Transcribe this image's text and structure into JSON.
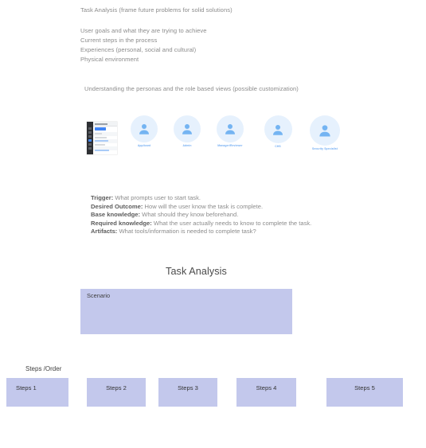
{
  "notes_top": [
    "Task Analysis (frame future problems for solid solutions)",
    "User goals and what they are trying to achieve",
    "Current steps in the process",
    "Experiences (personal, social and cultural)",
    "Physical environment"
  ],
  "notes_personas": "Understanding the personas and the role based views (possible customization)",
  "personas": [
    {
      "label": "Applicant",
      "icon": "user-avatar-icon"
    },
    {
      "label": "Admin",
      "icon": "user-avatar-icon"
    },
    {
      "label": "Manager/Reviewer",
      "icon": "user-avatar-icon"
    },
    {
      "label": "CHS",
      "icon": "user-avatar-icon"
    },
    {
      "label": "Security Specialist",
      "icon": "user-avatar-icon"
    }
  ],
  "app_thumbnail": {
    "name": "app-screenshot-thumbnail"
  },
  "definitions": [
    {
      "term": "Trigger:",
      "desc": " What prompts user to start task."
    },
    {
      "term": "Desired Outcome:",
      "desc": " How will the user know the task is complete."
    },
    {
      "term": "Base knowledge:",
      "desc": " What should they know beforehand."
    },
    {
      "term": "Required knowledge:",
      "desc": " What the user actually needs to know to complete the task."
    },
    {
      "term": "Artifacts:",
      "desc": " What tools/information is needed to complete task?"
    }
  ],
  "task_analysis": {
    "title": "Task Analysis",
    "scenario_label": "Scenario"
  },
  "steps": {
    "order_label": "Steps /Order",
    "items": [
      {
        "label": "Steps 1",
        "align": "left"
      },
      {
        "label": "Steps 2",
        "align": "center"
      },
      {
        "label": "Steps 3",
        "align": "center"
      },
      {
        "label": "Steps 4",
        "align": "center"
      },
      {
        "label": "Steps 5",
        "align": "center"
      }
    ]
  },
  "colors": {
    "box_fill": "#c3c8ec",
    "avatar_bg": "#e6f1fd",
    "avatar_figure": "#74b4f2",
    "persona_label": "#74aef2",
    "body_text": "#8c8c8c"
  }
}
